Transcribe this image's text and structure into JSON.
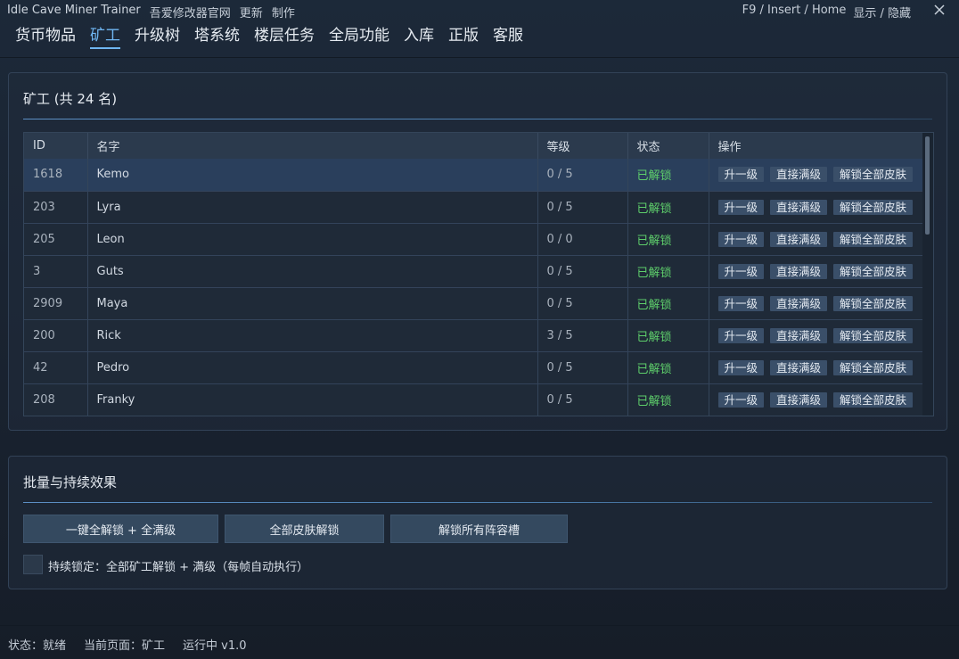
{
  "titlebar": {
    "app_title": "Idle Cave Miner Trainer",
    "links": [
      "吾爱修改器官网",
      "更新",
      "制作"
    ],
    "hotkeys": "F9 / Insert / Home",
    "toggle": "显示 / 隐藏",
    "close_icon": "close-icon"
  },
  "tabs": [
    {
      "label": "货币物品",
      "active": false
    },
    {
      "label": "矿工",
      "active": true
    },
    {
      "label": "升级树",
      "active": false
    },
    {
      "label": "塔系统",
      "active": false
    },
    {
      "label": "楼层任务",
      "active": false
    },
    {
      "label": "全局功能",
      "active": false
    },
    {
      "label": "入库",
      "active": false
    },
    {
      "label": "正版",
      "active": false
    },
    {
      "label": "客服",
      "active": false
    }
  ],
  "miners_panel": {
    "title": "矿工 (共 24 名)",
    "columns": [
      "ID",
      "名字",
      "等级",
      "状态",
      "操作"
    ],
    "op_labels": [
      "升一级",
      "直接满级",
      "解锁全部皮肤"
    ],
    "rows": [
      {
        "id": "1618",
        "name": "Kemo",
        "level": "0 / 5",
        "status": "已解锁",
        "selected": true
      },
      {
        "id": "203",
        "name": "Lyra",
        "level": "0 / 5",
        "status": "已解锁",
        "selected": false
      },
      {
        "id": "205",
        "name": "Leon",
        "level": "0 / 0",
        "status": "已解锁",
        "selected": false
      },
      {
        "id": "3",
        "name": "Guts",
        "level": "0 / 5",
        "status": "已解锁",
        "selected": false
      },
      {
        "id": "2909",
        "name": "Maya",
        "level": "0 / 5",
        "status": "已解锁",
        "selected": false
      },
      {
        "id": "200",
        "name": "Rick",
        "level": "3 / 5",
        "status": "已解锁",
        "selected": false
      },
      {
        "id": "42",
        "name": "Pedro",
        "level": "0 / 5",
        "status": "已解锁",
        "selected": false
      },
      {
        "id": "208",
        "name": "Franky",
        "level": "0 / 5",
        "status": "已解锁",
        "selected": false
      }
    ]
  },
  "batch_panel": {
    "title": "批量与持续效果",
    "buttons": [
      "一键全解锁 + 全满级",
      "全部皮肤解锁",
      "解锁所有阵容槽"
    ],
    "checkbox_label": "持续锁定：全部矿工解锁 + 满级（每帧自动执行）",
    "checkbox_checked": false
  },
  "statusbar": {
    "status": "状态：就绪",
    "current_page": "当前页面：矿工",
    "running": "运行中  v1.0"
  },
  "colors": {
    "accent": "#6fb6f2",
    "unlocked": "#5ecf6b",
    "selected_row": "#2a3f5c"
  }
}
